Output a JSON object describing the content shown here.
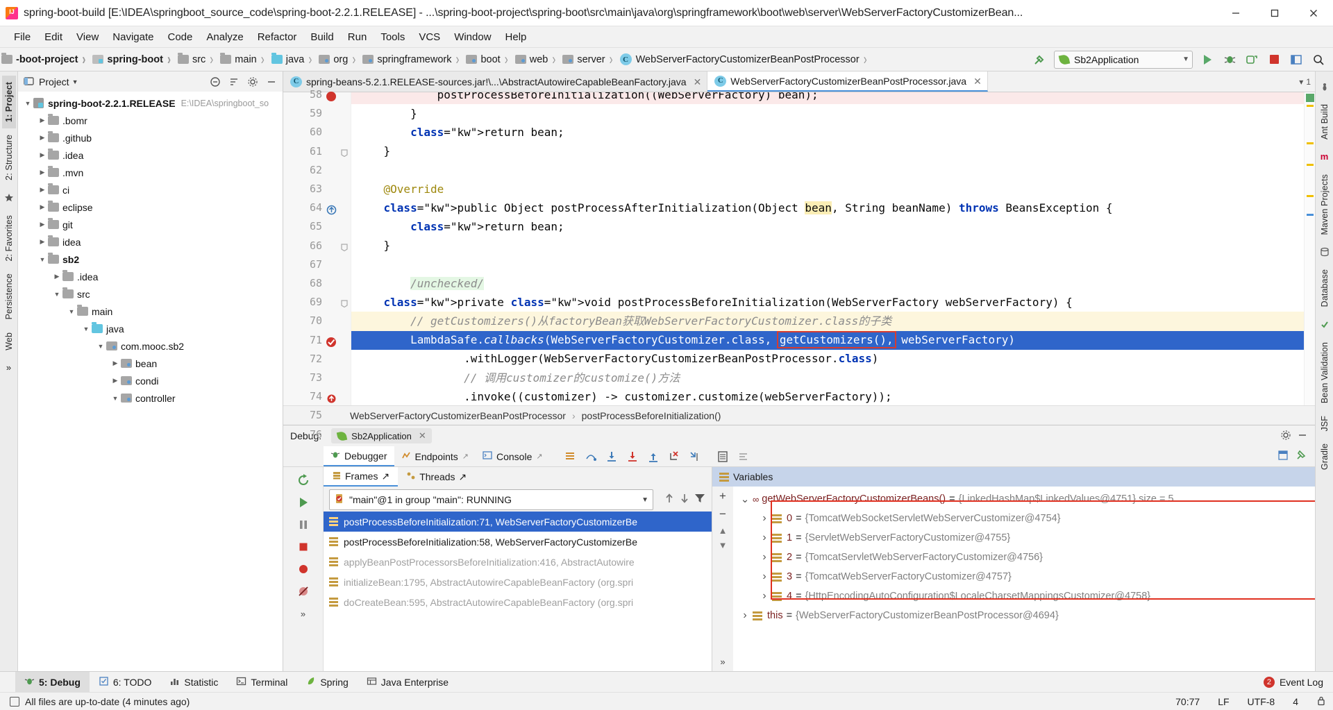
{
  "window": {
    "title": "spring-boot-build [E:\\IDEA\\springboot_source_code\\spring-boot-2.2.1.RELEASE] - ...\\spring-boot-project\\spring-boot\\src\\main\\java\\org\\springframework\\boot\\web\\server\\WebServerFactoryCustomizerBean...",
    "minimize": "minimize-button",
    "maximize": "maximize-button",
    "close": "close-button"
  },
  "menu": [
    {
      "label": "File"
    },
    {
      "label": "Edit"
    },
    {
      "label": "View"
    },
    {
      "label": "Navigate"
    },
    {
      "label": "Code"
    },
    {
      "label": "Analyze"
    },
    {
      "label": "Refactor"
    },
    {
      "label": "Build"
    },
    {
      "label": "Run"
    },
    {
      "label": "Tools"
    },
    {
      "label": "VCS"
    },
    {
      "label": "Window"
    },
    {
      "label": "Help"
    }
  ],
  "navbar": {
    "crumbs": [
      {
        "label": "-boot-project",
        "icon": "folder-grey",
        "bold": true
      },
      {
        "label": "spring-boot",
        "icon": "module",
        "bold": true
      },
      {
        "label": "src",
        "icon": "folder-grey",
        "bold": false
      },
      {
        "label": "main",
        "icon": "folder-grey",
        "bold": false
      },
      {
        "label": "java",
        "icon": "folder-source",
        "bold": false
      },
      {
        "label": "org",
        "icon": "folder-package",
        "bold": false
      },
      {
        "label": "springframework",
        "icon": "folder-package",
        "bold": false
      },
      {
        "label": "boot",
        "icon": "folder-package",
        "bold": false
      },
      {
        "label": "web",
        "icon": "folder-package",
        "bold": false
      },
      {
        "label": "server",
        "icon": "folder-package",
        "bold": false
      },
      {
        "label": "WebServerFactoryCustomizerBeanPostProcessor",
        "icon": "class",
        "bold": false
      }
    ],
    "run_config": "Sb2Application",
    "buttons": [
      "build-hammer-icon",
      "run-button",
      "debug-button",
      "run-with-coverage-button",
      "stop-button",
      "layout-button",
      "search-everywhere-icon"
    ]
  },
  "left_rail": [
    {
      "label": "1: Project",
      "active": true
    },
    {
      "label": "2: Structure",
      "active": false
    },
    {
      "label": "2: Favorites",
      "active": false
    },
    {
      "label": "Persistence",
      "active": false
    },
    {
      "label": "Web",
      "active": false
    }
  ],
  "right_rail": [
    {
      "label": "Ant Build"
    },
    {
      "label": "Maven Projects"
    },
    {
      "label": "Database"
    },
    {
      "label": "Bean Validation"
    },
    {
      "label": "JSF"
    },
    {
      "label": "Gradle"
    }
  ],
  "project_panel": {
    "title": "Project",
    "actions": [
      "collapse-all-icon",
      "sort-icon",
      "settings-gear-icon",
      "hide-icon"
    ],
    "tree": [
      {
        "depth": 0,
        "arrow": "down",
        "icon": "project",
        "label": "spring-boot-2.2.1.RELEASE",
        "path": "E:\\IDEA\\springboot_so",
        "bold": true
      },
      {
        "depth": 1,
        "arrow": "right",
        "icon": "folder-grey",
        "label": ".bomr",
        "path": "",
        "bold": false
      },
      {
        "depth": 1,
        "arrow": "right",
        "icon": "folder-grey",
        "label": ".github",
        "path": "",
        "bold": false
      },
      {
        "depth": 1,
        "arrow": "right",
        "icon": "folder-grey",
        "label": ".idea",
        "path": "",
        "bold": false
      },
      {
        "depth": 1,
        "arrow": "right",
        "icon": "folder-grey",
        "label": ".mvn",
        "path": "",
        "bold": false
      },
      {
        "depth": 1,
        "arrow": "right",
        "icon": "folder-grey",
        "label": "ci",
        "path": "",
        "bold": false
      },
      {
        "depth": 1,
        "arrow": "right",
        "icon": "folder-grey",
        "label": "eclipse",
        "path": "",
        "bold": false
      },
      {
        "depth": 1,
        "arrow": "right",
        "icon": "folder-grey",
        "label": "git",
        "path": "",
        "bold": false
      },
      {
        "depth": 1,
        "arrow": "right",
        "icon": "folder-grey",
        "label": "idea",
        "path": "",
        "bold": false
      },
      {
        "depth": 1,
        "arrow": "down",
        "icon": "folder-grey",
        "label": "sb2",
        "path": "",
        "bold": true
      },
      {
        "depth": 2,
        "arrow": "right",
        "icon": "folder-grey",
        "label": ".idea",
        "path": "",
        "bold": false
      },
      {
        "depth": 2,
        "arrow": "down",
        "icon": "folder-grey",
        "label": "src",
        "path": "",
        "bold": false
      },
      {
        "depth": 3,
        "arrow": "down",
        "icon": "folder-grey",
        "label": "main",
        "path": "",
        "bold": false
      },
      {
        "depth": 4,
        "arrow": "down",
        "icon": "folder-source",
        "label": "java",
        "path": "",
        "bold": false
      },
      {
        "depth": 5,
        "arrow": "down",
        "icon": "folder-package",
        "label": "com.mooc.sb2",
        "path": "",
        "bold": false
      },
      {
        "depth": 6,
        "arrow": "right",
        "icon": "folder-package",
        "label": "bean",
        "path": "",
        "bold": false
      },
      {
        "depth": 6,
        "arrow": "right",
        "icon": "folder-package",
        "label": "condi",
        "path": "",
        "bold": false
      },
      {
        "depth": 6,
        "arrow": "down",
        "icon": "folder-package",
        "label": "controller",
        "path": "",
        "bold": false
      }
    ]
  },
  "editor": {
    "tabs": [
      {
        "label": "spring-beans-5.2.1.RELEASE-sources.jar!\\...\\AbstractAutowireCapableBeanFactory.java",
        "active": false,
        "icon": "class"
      },
      {
        "label": "WebServerFactoryCustomizerBeanPostProcessor.java",
        "active": true,
        "icon": "class"
      }
    ],
    "tab_overflow": "1",
    "lines": [
      {
        "num": "58",
        "text": "            postProcessBeforeInitialization((WebServerFactory) bean);",
        "style": "pink-partial"
      },
      {
        "num": "59",
        "text": "        }",
        "style": ""
      },
      {
        "num": "60",
        "text": "        return bean;",
        "style": ""
      },
      {
        "num": "61",
        "text": "    }",
        "style": "fold"
      },
      {
        "num": "62",
        "text": "",
        "style": ""
      },
      {
        "num": "63",
        "text": "    @Override",
        "style": "annotation"
      },
      {
        "num": "64",
        "text": "    public Object postProcessAfterInitialization(Object bean, String beanName) throws BeansException {",
        "style": "override-marker"
      },
      {
        "num": "65",
        "text": "        return bean;",
        "style": ""
      },
      {
        "num": "66",
        "text": "    }",
        "style": "fold"
      },
      {
        "num": "67",
        "text": "",
        "style": ""
      },
      {
        "num": "68",
        "text": "    /unchecked/",
        "style": "green-highlight"
      },
      {
        "num": "69",
        "text": "    private void postProcessBeforeInitialization(WebServerFactory webServerFactory) {",
        "style": "fold"
      },
      {
        "num": "70",
        "text": "        // getCustomizers()从factoryBean获取WebServerFactoryCustomizer.class的子类",
        "style": "comment-cream"
      },
      {
        "num": "71",
        "text": "        LambdaSafe.callbacks(WebServerFactoryCustomizer.class, getCustomizers(), webServerFactory)",
        "style": "selected-breakpoint"
      },
      {
        "num": "72",
        "text": "                .withLogger(WebServerFactoryCustomizerBeanPostProcessor.class)",
        "style": ""
      },
      {
        "num": "73",
        "text": "                // 调用customizer的customize()方法",
        "style": "comment"
      },
      {
        "num": "74",
        "text": "                .invoke((customizer) -> customizer.customize(webServerFactory));",
        "style": "error-marker"
      },
      {
        "num": "75",
        "text": "    }",
        "style": ""
      },
      {
        "num": "76",
        "text": "",
        "style": ""
      }
    ],
    "highlighted_token": "getCustomizers(),",
    "breadcrumb": [
      "WebServerFactoryCustomizerBeanPostProcessor",
      "postProcessBeforeInitialization()"
    ]
  },
  "debug": {
    "label": "Debug:",
    "config_tab": "Sb2Application",
    "tabs": [
      {
        "label": "Debugger",
        "icon": "debugger-icon",
        "active": true
      },
      {
        "label": "Endpoints",
        "icon": "endpoints-icon",
        "active": false
      },
      {
        "label": "Console",
        "icon": "console-icon",
        "active": false
      }
    ],
    "toolbar_icons": [
      "show-execution-point-icon",
      "step-over-icon",
      "step-into-icon",
      "force-step-into-icon",
      "step-out-icon",
      "drop-frame-icon",
      "run-to-cursor-icon",
      "evaluate-expression-icon",
      "settings-icon"
    ],
    "left_icons": [
      "rerun-icon",
      "resume-icon",
      "pause-icon",
      "stop-icon",
      "view-breakpoints-icon",
      "mute-breakpoints-icon",
      "settings-icon"
    ],
    "frames": {
      "tabs": [
        {
          "label": "Frames",
          "active": true
        },
        {
          "label": "Threads",
          "active": false
        }
      ],
      "thread": "\"main\"@1 in group \"main\": RUNNING",
      "rows": [
        {
          "label": "postProcessBeforeInitialization:71, WebServerFactoryCustomizerBe",
          "selected": true,
          "dim": false
        },
        {
          "label": "postProcessBeforeInitialization:58, WebServerFactoryCustomizerBe",
          "selected": false,
          "dim": false
        },
        {
          "label": "applyBeanPostProcessorsBeforeInitialization:416, AbstractAutowire",
          "selected": false,
          "dim": true
        },
        {
          "label": "initializeBean:1795, AbstractAutowireCapableBeanFactory (org.spri",
          "selected": false,
          "dim": true
        },
        {
          "label": "doCreateBean:595, AbstractAutowireCapableBeanFactory (org.spri",
          "selected": false,
          "dim": true
        }
      ]
    },
    "variables": {
      "title": "Variables",
      "rows": [
        {
          "indent": 0,
          "arrow": "down",
          "icon": "method",
          "name": "getWebServerFactoryCustomizerBeans()",
          "value": "{LinkedHashMap$LinkedValues@4751}  size = 5",
          "boxed": false
        },
        {
          "indent": 1,
          "arrow": "right",
          "icon": "field",
          "name": "0",
          "value": "{TomcatWebSocketServletWebServerCustomizer@4754}",
          "boxed": true
        },
        {
          "indent": 1,
          "arrow": "right",
          "icon": "field",
          "name": "1",
          "value": "{ServletWebServerFactoryCustomizer@4755}",
          "boxed": true
        },
        {
          "indent": 1,
          "arrow": "right",
          "icon": "field",
          "name": "2",
          "value": "{TomcatServletWebServerFactoryCustomizer@4756}",
          "boxed": true
        },
        {
          "indent": 1,
          "arrow": "right",
          "icon": "field",
          "name": "3",
          "value": "{TomcatWebServerFactoryCustomizer@4757}",
          "boxed": true
        },
        {
          "indent": 1,
          "arrow": "right",
          "icon": "field",
          "name": "4",
          "value": "{HttpEncodingAutoConfiguration$LocaleCharsetMappingsCustomizer@4758}",
          "boxed": true
        },
        {
          "indent": 0,
          "arrow": "right",
          "icon": "field",
          "name": "this",
          "value": "{WebServerFactoryCustomizerBeanPostProcessor@4694}",
          "boxed": false
        }
      ]
    }
  },
  "bottom_tabs": [
    {
      "label": "5: Debug",
      "icon": "debug-icon",
      "active": true
    },
    {
      "label": "6: TODO",
      "icon": "todo-icon",
      "active": false
    },
    {
      "label": "Statistic",
      "icon": "statistic-icon",
      "active": false
    },
    {
      "label": "Terminal",
      "icon": "terminal-icon",
      "active": false
    },
    {
      "label": "Spring",
      "icon": "spring-leaf-icon",
      "active": false
    },
    {
      "label": "Java Enterprise",
      "icon": "java-ee-icon",
      "active": false
    }
  ],
  "event_log": {
    "label": "Event Log",
    "count": "2"
  },
  "statusbar": {
    "message": "All files are up-to-date (4 minutes ago)",
    "caret": "70:77",
    "line_sep": "LF",
    "encoding": "UTF-8",
    "indent": "4"
  },
  "colors": {
    "accent_blue": "#2f65ca",
    "selection_red": "#e03020",
    "keyword_blue": "#0033b3",
    "comment_grey": "#8c8c8c",
    "green_run": "#59a869",
    "stop_red": "#d0342c",
    "spring_green": "#6db33f"
  }
}
